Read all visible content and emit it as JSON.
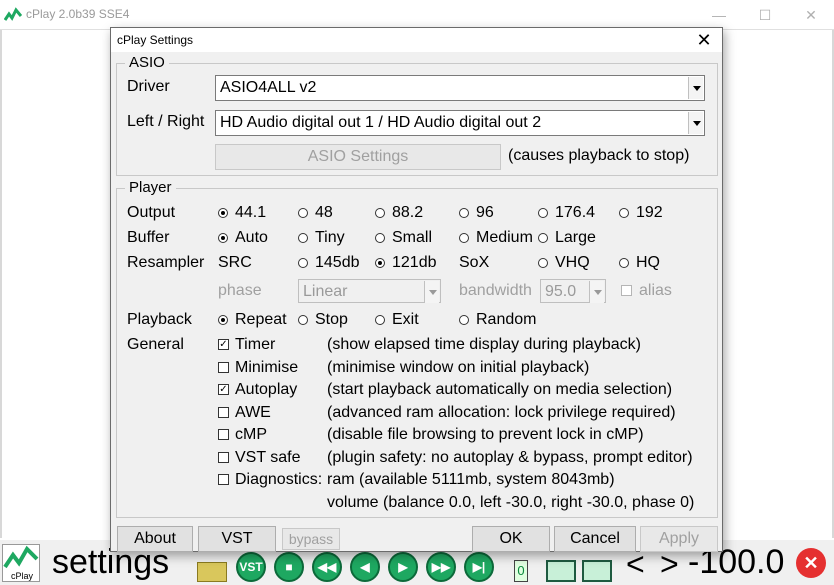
{
  "main_window": {
    "title": "cPlay 2.0b39 SSE4",
    "minimize_glyph": "—",
    "maximize_glyph": "☐",
    "logo_text": "cPlay",
    "big_label": "settings",
    "transport_labels": [
      "VST",
      "■",
      "◀◀",
      "◀",
      "▶",
      "▶▶",
      "▶|"
    ],
    "counter": "0",
    "nav_prev": "<",
    "nav_next": ">",
    "volume": "-100.0",
    "close_glyph": "✕",
    "accent_green": "#1ea861",
    "close_red": "#e53030"
  },
  "dialog": {
    "title": "cPlay Settings",
    "close_glyph": "✕",
    "asio": {
      "group_label": "ASIO",
      "driver_label": "Driver",
      "driver_value": "ASIO4ALL v2",
      "lr_label": "Left / Right",
      "lr_value": "HD Audio digital out 1 / HD Audio digital out 2",
      "settings_button": "ASIO Settings",
      "settings_note": "(causes playback to stop)"
    },
    "player": {
      "group_label": "Player",
      "output_label": "Output",
      "output_options": [
        "44.1",
        "48",
        "88.2",
        "96",
        "176.4",
        "192"
      ],
      "output_selected": "44.1",
      "buffer_label": "Buffer",
      "buffer_options": [
        "Auto",
        "Tiny",
        "Small",
        "Medium",
        "Large"
      ],
      "buffer_selected": "Auto",
      "resampler_label": "Resampler",
      "src_label": "SRC",
      "src_options": [
        "145db",
        "121db"
      ],
      "src_selected": "121db",
      "sox_label": "SoX",
      "sox_options": [
        "VHQ",
        "HQ"
      ],
      "phase_label": "phase",
      "phase_value": "Linear",
      "bandwidth_label": "bandwidth",
      "bandwidth_value": "95.0",
      "alias_label": "alias",
      "playback_label": "Playback",
      "playback_options": [
        "Repeat",
        "Stop",
        "Exit",
        "Random"
      ],
      "playback_selected": "Repeat",
      "general_label": "General",
      "general_items": [
        {
          "label": "Timer",
          "checked": true,
          "desc": "(show elapsed time display during playback)"
        },
        {
          "label": "Minimise",
          "checked": false,
          "desc": "(minimise window on initial playback)"
        },
        {
          "label": "Autoplay",
          "checked": true,
          "desc": "(start playback automatically on media selection)"
        },
        {
          "label": "AWE",
          "checked": false,
          "desc": "(advanced ram allocation: lock privilege required)"
        },
        {
          "label": "cMP",
          "checked": false,
          "desc": "(disable file browsing to prevent lock in cMP)"
        },
        {
          "label": "VST safe",
          "checked": false,
          "desc": "(plugin safety: no autoplay & bypass, prompt editor)"
        },
        {
          "label": "Diagnostics:",
          "checked": false,
          "desc": "ram (available 5111mb, system 8043mb)"
        }
      ],
      "volume_line": "volume (balance  0.0, left -30.0, right -30.0, phase 0)"
    },
    "buttons": {
      "about": "About",
      "vst": "VST",
      "bypass": "bypass",
      "ok": "OK",
      "cancel": "Cancel",
      "apply": "Apply"
    }
  }
}
